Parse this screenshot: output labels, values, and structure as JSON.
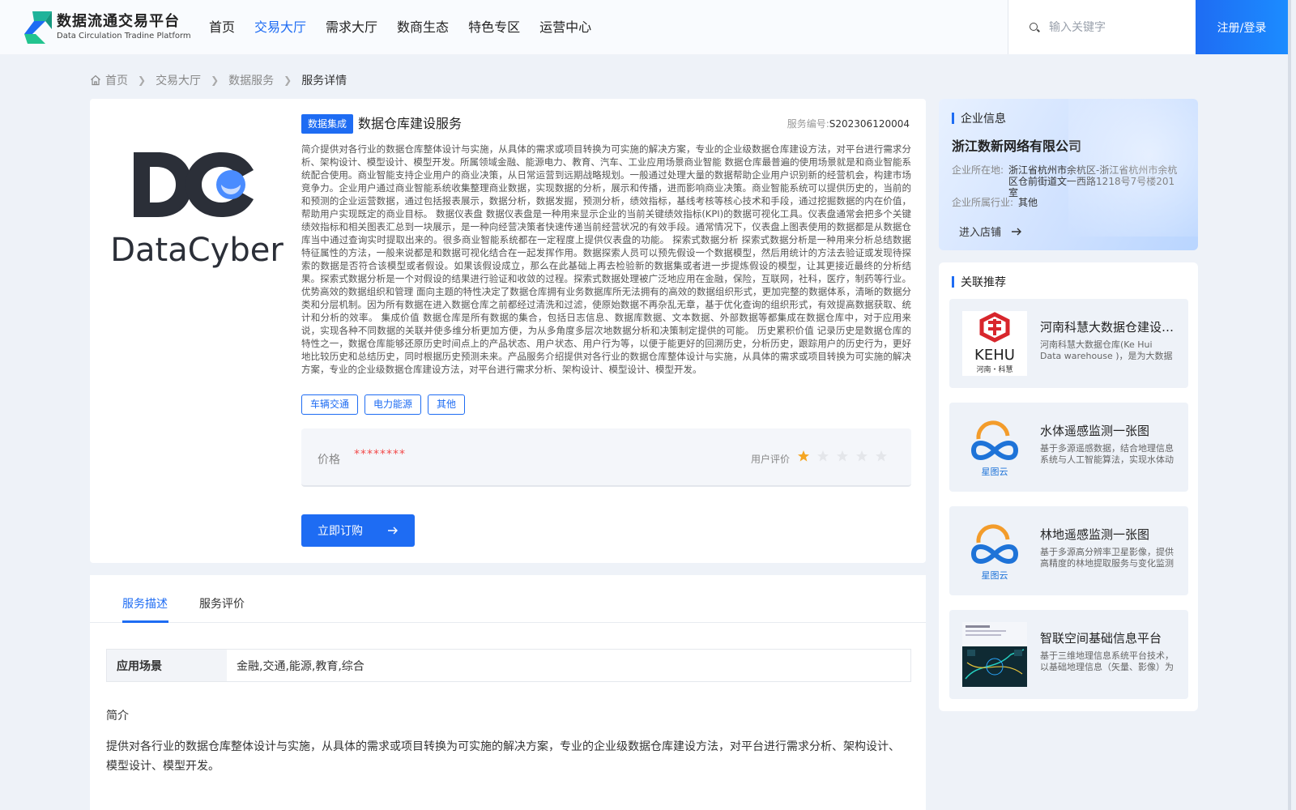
{
  "header": {
    "logo_title": "数据流通交易平台",
    "logo_subtitle": "Data Circulation Tradine Platform",
    "nav": [
      "首页",
      "交易大厅",
      "需求大厅",
      "数商生态",
      "特色专区",
      "运营中心"
    ],
    "nav_active": "交易大厅",
    "search_placeholder": "输入关键字",
    "login_label": "注册/登录"
  },
  "breadcrumb": [
    "首页",
    "交易大厅",
    "数据服务",
    "服务详情"
  ],
  "product": {
    "logo_text": "DataCyber",
    "category_tag": "数据集成",
    "title": "数据仓库建设服务",
    "code_label": "服务编号:",
    "code_value": "S202306120004",
    "description": "简介提供对各行业的数据仓库整体设计与实施，从具体的需求或项目转换为可实施的解决方案，专业的企业级数据仓库建设方法，对平台进行需求分析、架构设计、模型设计、模型开发。所属领域金融、能源电力、教育、汽车、工业应用场景商业智能 数据仓库最普遍的使用场景就是和商业智能系统配合使用。商业智能支持企业用户的商业决策，从日常运营到远期战略规划。一般通过处理大量的数据帮助企业用户识别新的经营机会，构建市场竞争力。企业用户通过商业智能系统收集整理商业数据，实现数据的分析，展示和传播，进而影响商业决策。商业智能系统可以提供历史的，当前的和预测的企业运营数据，通过包括报表展示，数据分析，数据发掘，预测分析，绩效指标，基线考核等核心技术和手段，通过挖掘数据的内在价值，帮助用户实现既定的商业目标。 数据仪表盘 数据仪表盘是一种用来显示企业的当前关键绩效指标(KPI)的数据可视化工具。仪表盘通常会把多个关键绩效指标和相关图表汇总到一块展示，是一种向经营决策者快速传递当前经营状况的有效手段。通常情况下，仪表盘上图表使用的数据都是从数据仓库当中通过查询实时提取出来的。很多商业智能系统都在一定程度上提供仪表盘的功能。 探索式数据分析 探索式数据分析是一种用来分析总结数据特征属性的方法，一般来说都是和数据可视化结合在一起发挥作用。数据探索人员可以预先假设一个数据模型，然后用统计的方法去验证或发现待探索的数据是否符合该模型或者假设。如果该假设成立，那么在此基础上再去检验新的数据集或者进一步提炼假设的模型，让其更接近最终的分析结果。探索式数据分析是一个对假设的结果进行验证和收敛的过程。探索式数据处理被广泛地应用在金融，保险，互联网，社科，医疗，制药等行业。优势高效的数据组织和管理 面向主题的特性决定了数据仓库拥有业务数据库所无法拥有的高效的数据组织形式，更加完整的数据体系，清晰的数据分类和分层机制。因为所有数据在进入数据仓库之前都经过清洗和过滤，使原始数据不再杂乱无章，基于优化查询的组织形式，有效提高数据获取、统计和分析的效率。 集成价值 数据仓库是所有数据的集合，包括日志信息、数据库数据、文本数据、外部数据等都集成在数据仓库中，对于应用来说，实现各种不同数据的关联并使多维分析更加方便，为从多角度多层次地数据分析和决策制定提供的可能。 历史累积价值 记录历史是数据仓库的特性之一，数据仓库能够还原历史时间点上的产品状态、用户状态、用户行为等，以便于能更好的回溯历史，分析历史，跟踪用户的历史行为，更好地比较历史和总结历史，同时根据历史预测未来。产品服务介绍提供对各行业的数据仓库整体设计与实施，从具体的需求或项目转换为可实施的解决方案，专业的企业级数据仓库建设方法，对平台进行需求分析、架构设计、模型设计、模型开发。",
    "tags": [
      "车辆交通",
      "电力能源",
      "其他"
    ],
    "price_label": "价格",
    "price_value": "********",
    "rating_label": "用户评价",
    "rating": 1,
    "rating_max": 5,
    "buy_label": "立即订购"
  },
  "detail": {
    "tabs": [
      "服务描述",
      "服务评价"
    ],
    "active_tab": "服务描述",
    "scene_label": "应用场景",
    "scene_value": "金融,交通,能源,教育,综合",
    "intro_title": "简介",
    "intro_text": "提供对各行业的数据仓库整体设计与实施，从具体的需求或项目转换为可实施的解决方案，专业的企业级数据仓库建设方法，对平台进行需求分析、架构设计、模型设计、模型开发。"
  },
  "company": {
    "section_title": "企业信息",
    "name": "浙江数新网络有限公司",
    "location_label": "企业所在地:",
    "location_value": "浙江省杭州市余杭区-浙江省杭州市余杭区仓前街道文一西路1218号7号楼201室",
    "industry_label": "企业所属行业:",
    "industry_value": "其他",
    "enter_label": "进入店铺"
  },
  "recommend": {
    "section_title": "关联推荐",
    "items": [
      {
        "title": "河南科慧大数据仓建设服务",
        "desc": "河南科慧大数据仓库(Ke Hui Data warehouse )，是为大数据仓库建设提供的综合服务",
        "thumb": "kehui",
        "thumb_text": "KEHU",
        "thumb_caption": "河南・科慧"
      },
      {
        "title": "水体遥感监测一张图",
        "desc": "基于多源遥感数据，结合地理信息系统与人工智能算法，实现水体动态监测",
        "thumb": "xingtuyun",
        "thumb_caption": "星图云"
      },
      {
        "title": "林地遥感监测一张图",
        "desc": "基于多源高分辨率卫星影像，提供高精度的林地提取服务与变化监测",
        "thumb": "xingtuyun",
        "thumb_caption": "星图云"
      },
      {
        "title": "智联空间基础信息平台",
        "desc": "基于三维地理信息系统平台技术，以基础地理信息（矢量、影像）为底座",
        "thumb": "screenshot"
      }
    ]
  },
  "colors": {
    "accent": "#1e6cf3",
    "price": "#f24b4b",
    "star_on": "#f5a623",
    "star_off": "#e4e6ea"
  }
}
